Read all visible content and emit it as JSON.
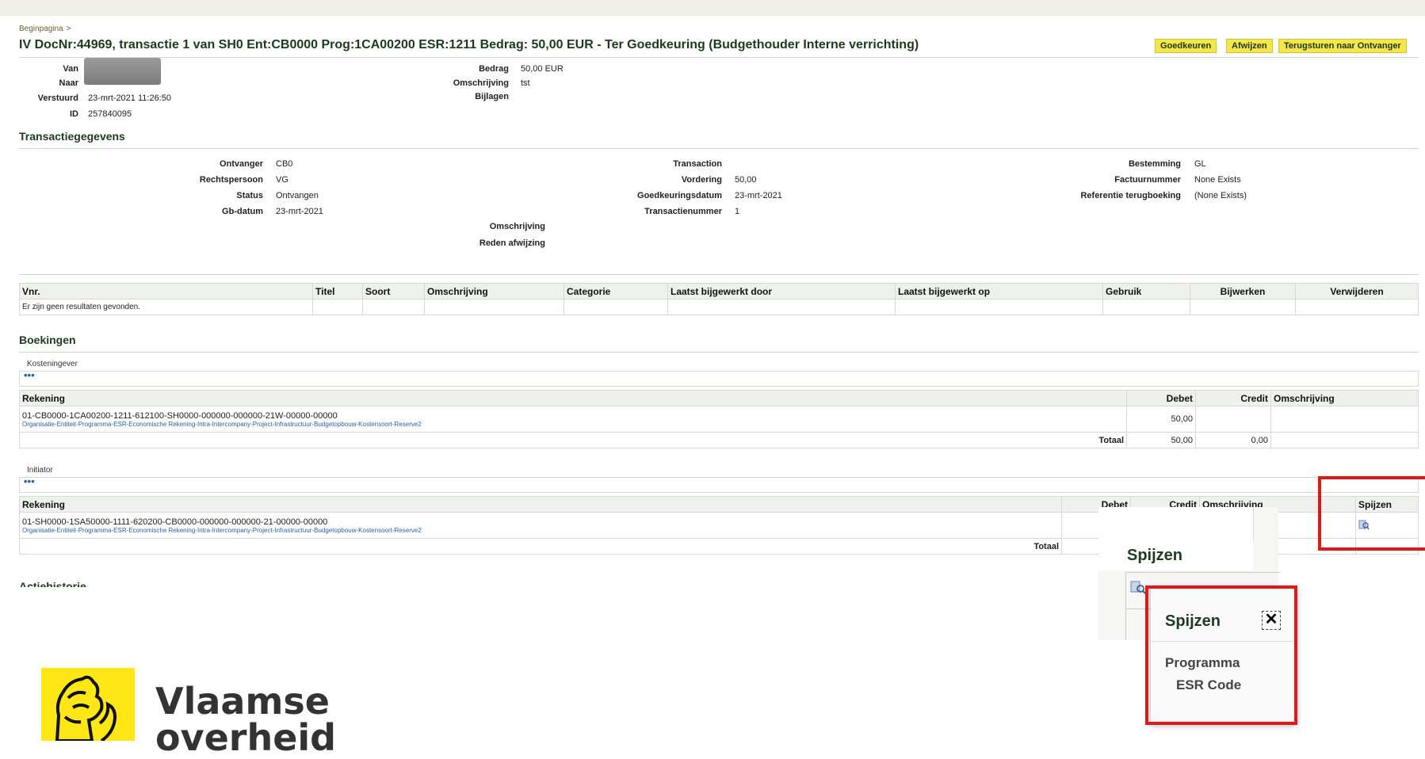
{
  "breadcrumb": {
    "home": "Beginpagina",
    "sep": ">"
  },
  "title": "IV DocNr:44969, transactie 1 van SH0 Ent:CB0000 Prog:1CA00200 ESR:1211 Bedrag: 50,00 EUR - Ter Goedkeuring (Budgethouder Interne verrichting)",
  "actions": {
    "approve": "Goedkeuren",
    "reject": "Afwijzen",
    "return": "Terugsturen naar Ontvanger"
  },
  "header": {
    "van_label": "Van",
    "naar_label": "Naar",
    "verstuurd_label": "Verstuurd",
    "verstuurd": "23-mrt-2021 11:26:50",
    "id_label": "ID",
    "id": "257840095",
    "bedrag_label": "Bedrag",
    "bedrag": "50,00 EUR",
    "omschrijving_label": "Omschrijving",
    "omschrijving": "tst",
    "bijlagen_label": "Bijlagen"
  },
  "transaction": {
    "heading": "Transactiegegevens",
    "ontvanger_label": "Ontvanger",
    "ontvanger": "CB0",
    "rechtspersoon_label": "Rechtspersoon",
    "rechtspersoon": "VG",
    "status_label": "Status",
    "status": "Ontvangen",
    "gbdatum_label": "Gb-datum",
    "gbdatum": "23-mrt-2021",
    "omschrijving_label": "Omschrijving",
    "reden_label": "Reden afwijzing",
    "transaction_label": "Transaction",
    "vordering_label": "Vordering",
    "vordering": "50,00",
    "goedkeuring_label": "Goedkeuringsdatum",
    "goedkeuring": "23-mrt-2021",
    "transactienummer_label": "Transactienummer",
    "transactienummer": "1",
    "bestemming_label": "Bestemming",
    "bestemming": "GL",
    "factuur_label": "Factuurnummer",
    "factuur": "None Exists",
    "referentie_label": "Referentie terugboeking",
    "referentie": "(None Exists)"
  },
  "attachments_table": {
    "columns": [
      "Vnr.",
      "Titel",
      "Soort",
      "Omschrijving",
      "Categorie",
      "Laatst bijgewerkt door",
      "Laatst bijgewerkt op",
      "Gebruik",
      "Bijwerken",
      "Verwijderen"
    ],
    "empty": "Er zijn geen resultaten gevonden."
  },
  "bookings": {
    "heading": "Boekingen",
    "kostengever": {
      "label": "Kosteningever",
      "dots": "•••",
      "col_rekening": "Rekening",
      "col_debet": "Debet",
      "col_credit": "Credit",
      "col_omschrijving": "Omschrijving",
      "account": "01-CB0000-1CA00200-1211-612100-SH0000-000000-000000-21W-00000-00000",
      "account_desc": "Organisatie-Entiteit-Programma-ESR-Economische Rekening-Intra-Intercompany-Project-Infrastructuur-Budgetopbouw-Kostensoort-Reserve2",
      "debet": "50,00",
      "totaal_label": "Totaal",
      "totaal_debet": "50,00",
      "totaal_credit": "0,00"
    },
    "initiator": {
      "label": "Initiator",
      "dots": "•••",
      "col_rekening": "Rekening",
      "col_debet": "Debet",
      "col_credit": "Credit",
      "col_omschrijving": "Omschrijving",
      "col_spijzen": "Spijzen",
      "account": "01-SH0000-1SA50000-1111-620200-CB0000-000000-000000-21-00000-00000",
      "account_desc": "Organisatie-Entiteit-Programma-ESR-Economische Rekening-Intra-Intercompany-Project-Infrastructuur-Budgetopbouw-Kostensoort-Reserve2",
      "totaal_label": "Totaal"
    }
  },
  "history_heading": "Actiehistorie",
  "zoom_header": "Spijzen",
  "popup": {
    "title": "Spijzen",
    "close": "✕",
    "item1": "Programma",
    "item2": "ESR Code"
  },
  "logo": {
    "line1": "Vlaamse",
    "line2": "overheid"
  },
  "colors": {
    "accent_button": "#f3e74a",
    "highlight": "#e01818",
    "logo_yellow": "#ffe615"
  }
}
